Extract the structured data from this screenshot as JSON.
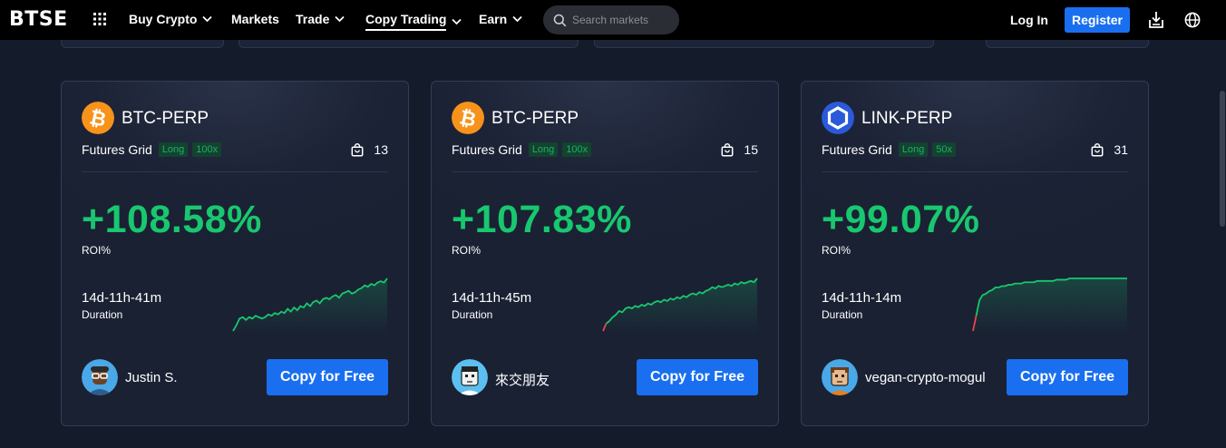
{
  "nav": {
    "logo": "BTSE",
    "items": [
      {
        "label": "Buy Crypto",
        "dropdown": true
      },
      {
        "label": "Markets",
        "dropdown": false
      },
      {
        "label": "Trade",
        "dropdown": true
      },
      {
        "label": "Copy Trading",
        "dropdown": true,
        "active": true
      },
      {
        "label": "Earn",
        "dropdown": true
      }
    ],
    "search_placeholder": "Search markets",
    "login": "Log In",
    "register": "Register"
  },
  "colors": {
    "accent": "#1a6ff0",
    "positive": "#18c76f",
    "tag_bg": "#14432f",
    "background": "#141b2a",
    "card": "#1c2336"
  },
  "cards": [
    {
      "pair": "BTC-PERP",
      "coin_icon": "bitcoin-icon",
      "strategy": "Futures Grid",
      "direction": "Long",
      "leverage": "100x",
      "followers": "13",
      "roi": "+108.58%",
      "roi_label": "ROI%",
      "duration": "14d-11h-41m",
      "duration_label": "Duration",
      "trader": "Justin S.",
      "copy_label": "Copy for Free",
      "sparkline": [
        0,
        4,
        9,
        10,
        8,
        10,
        9,
        11,
        10,
        9,
        10,
        12,
        11,
        13,
        12,
        14,
        13,
        16,
        14,
        17,
        15,
        18,
        17,
        20,
        18,
        21,
        22,
        20,
        23,
        24,
        23,
        25,
        26,
        24,
        27,
        28,
        29,
        27,
        28,
        30,
        31,
        33,
        32,
        34,
        33,
        35,
        36,
        35,
        38
      ]
    },
    {
      "pair": "BTC-PERP",
      "coin_icon": "bitcoin-icon",
      "strategy": "Futures Grid",
      "direction": "Long",
      "leverage": "100x",
      "followers": "15",
      "roi": "+107.83%",
      "roi_label": "ROI%",
      "duration": "14d-11h-45m",
      "duration_label": "Duration",
      "trader": "來交朋友",
      "copy_label": "Copy for Free",
      "sparkline": [
        -2,
        4,
        6,
        9,
        11,
        14,
        13,
        16,
        17,
        16,
        18,
        17,
        19,
        18,
        20,
        19,
        21,
        22,
        21,
        23,
        22,
        24,
        23,
        25,
        24,
        26,
        25,
        27,
        28,
        27,
        29,
        28,
        30,
        31,
        33,
        32,
        34,
        33,
        34,
        35,
        34,
        36,
        35,
        37,
        36,
        37,
        38,
        37,
        40
      ]
    },
    {
      "pair": "LINK-PERP",
      "coin_icon": "chainlink-icon",
      "strategy": "Futures Grid",
      "direction": "Long",
      "leverage": "50x",
      "followers": "31",
      "roi": "+99.07%",
      "roi_label": "ROI%",
      "duration": "14d-11h-14m",
      "duration_label": "Duration",
      "trader": "vegan-crypto-mogul",
      "copy_label": "Copy for Free",
      "sparkline": [
        -4,
        8,
        20,
        24,
        25,
        27,
        28,
        30,
        30,
        31,
        31,
        32,
        32,
        33,
        33,
        33,
        34,
        34,
        34,
        34,
        35,
        35,
        35,
        35,
        35,
        35,
        36,
        36,
        36,
        36,
        37,
        37,
        37,
        37,
        37,
        37,
        37,
        37,
        37,
        37,
        37,
        37,
        37,
        37,
        37,
        37,
        37,
        37,
        37
      ]
    }
  ]
}
